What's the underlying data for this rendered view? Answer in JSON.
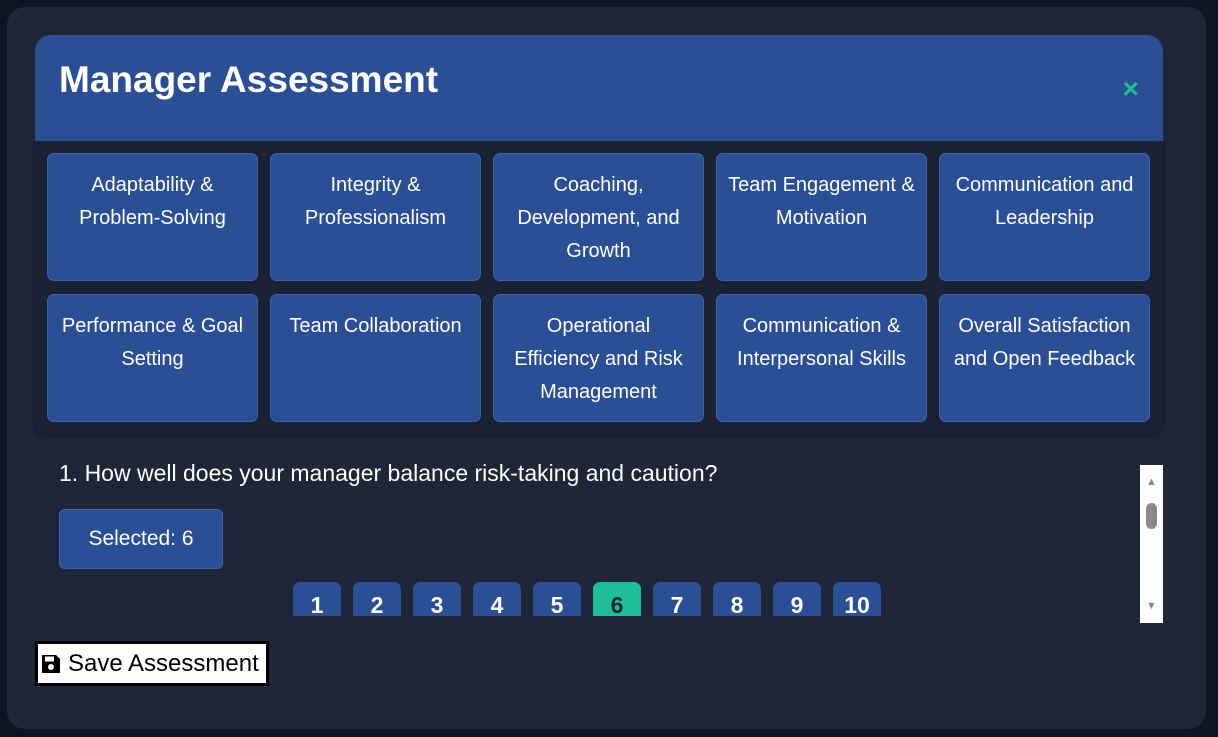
{
  "header": {
    "title": "Manager Assessment",
    "close_glyph": "×"
  },
  "categories": [
    "Adaptability & Problem-Solving",
    "Integrity & Professionalism",
    "Coaching, Development, and Growth",
    "Team Engagement & Motivation",
    "Communication and Leadership",
    "Performance & Goal Setting",
    "Team Collaboration",
    "Operational Efficiency and Risk Management",
    "Communication & Interpersonal Skills",
    "Overall Satisfaction and Open Feedback"
  ],
  "question": {
    "text": "1. How well does your manager balance risk-taking and caution?",
    "selected_label": "Selected: 6",
    "selected_value": 6,
    "ratings": [
      "1",
      "2",
      "3",
      "4",
      "5",
      "6",
      "7",
      "8",
      "9",
      "10"
    ]
  },
  "scrollbar": {
    "up_glyph": "▲",
    "down_glyph": "▼"
  },
  "footer": {
    "save_label": "Save Assessment"
  },
  "colors": {
    "background": "#1e2638",
    "header": "#2b4f94",
    "accent": "#1fbf9a",
    "text": "#ffffff"
  }
}
